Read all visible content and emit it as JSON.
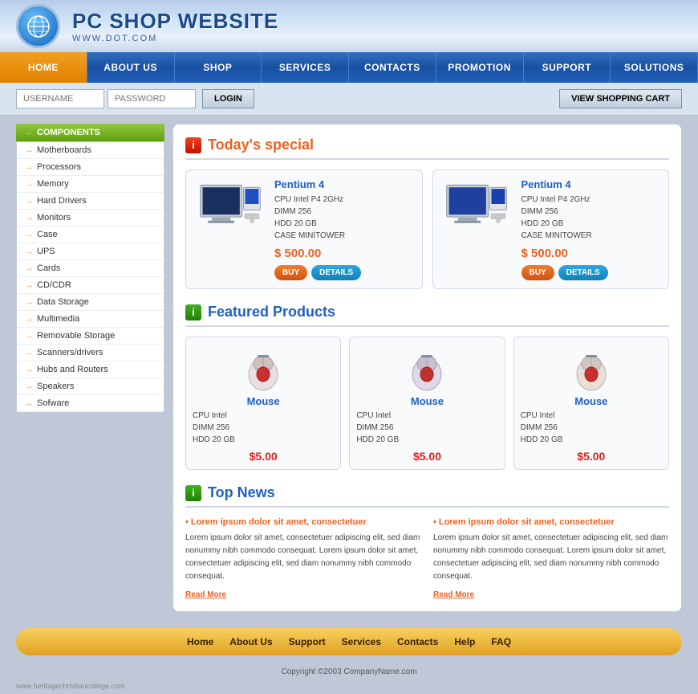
{
  "site": {
    "title": "PC SHOP WEBSITE",
    "subtitle": "WWW.DOT.COM",
    "watermark": "www.heritagechristiancollege.com"
  },
  "nav": {
    "items": [
      {
        "label": "HOME",
        "active": true
      },
      {
        "label": "ABOUT US",
        "active": false
      },
      {
        "label": "SHOP",
        "active": false
      },
      {
        "label": "SERVICES",
        "active": false
      },
      {
        "label": "CONTACTS",
        "active": false
      },
      {
        "label": "PROMOTION",
        "active": false
      },
      {
        "label": "SUPPORT",
        "active": false
      },
      {
        "label": "SOLUTIONS",
        "active": false
      }
    ]
  },
  "login": {
    "username_placeholder": "USERNAME",
    "password_placeholder": "PASSWORD",
    "login_label": "LOGIN",
    "cart_label": "VIEW SHOPPING CART"
  },
  "sidebar": {
    "header": "COMPONENTS",
    "items": [
      "Motherboards",
      "Processors",
      "Memory",
      "Hard Drivers",
      "Monitors",
      "Case",
      "UPS",
      "Cards",
      "CD/CDR",
      "Data Storage",
      "Multimedia",
      "Removable Storage",
      "Scanners/drivers",
      "Hubs and Routers",
      "Speakers",
      "Sofware"
    ]
  },
  "todays_special": {
    "title": "Today's special",
    "products": [
      {
        "name": "Pentium 4",
        "desc_line1": "CPU Intel P4 2GHz",
        "desc_line2": "DIMM 256",
        "desc_line3": "HDD 20 GB",
        "desc_line4": "CASE MINITOWER",
        "price": "$ 500.00",
        "buy_label": "BUY",
        "details_label": "DETAILS"
      },
      {
        "name": "Pentium 4",
        "desc_line1": "CPU Intel P4 2GHz",
        "desc_line2": "DIMM 256",
        "desc_line3": "HDD 20 GB",
        "desc_line4": "CASE MINITOWER",
        "price": "$ 500.00",
        "buy_label": "BUY",
        "details_label": "DETAILS"
      }
    ]
  },
  "featured_products": {
    "title": "Featured Products",
    "products": [
      {
        "name": "Mouse",
        "desc_line1": "CPU Intel",
        "desc_line2": "DIMM 256",
        "desc_line3": "HDD 20 GB",
        "price": "$5.00"
      },
      {
        "name": "Mouse",
        "desc_line1": "CPU Intel",
        "desc_line2": "DIMM 256",
        "desc_line3": "HDD 20 GB",
        "price": "$5.00"
      },
      {
        "name": "Mouse",
        "desc_line1": "CPU Intel",
        "desc_line2": "DIMM 256",
        "desc_line3": "HDD 20 GB",
        "price": "$5.00"
      }
    ]
  },
  "top_news": {
    "title": "Top News",
    "items": [
      {
        "headline": "Lorem ipsum dolor sit amet, consectetuer",
        "body": "Lorem ipsum dolor sit amet, consectetuer adipiscing elit, sed diam nonummy nibh commodo consequat. Lorem ipsum dolor sit amet, consectetuer adipiscing elit, sed diam nonummy nibh commodo consequat.",
        "read_more": "Read More"
      },
      {
        "headline": "Lorem ipsum dolor sit amet, consectetuer",
        "body": "Lorem ipsum dolor sit amet, consectetuer adipiscing elit, sed diam nonummy nibh commodo consequat. Lorem ipsum dolor sit amet, consectetuer adipiscing elit, sed diam nonummy nibh commodo consequat.",
        "read_more": "Read More"
      }
    ]
  },
  "footer_nav": {
    "items": [
      "Home",
      "About Us",
      "Support",
      "Services",
      "Contacts",
      "Help",
      "FAQ"
    ]
  },
  "footer": {
    "copyright": "Copyright ©2003 CompanyName.com"
  }
}
